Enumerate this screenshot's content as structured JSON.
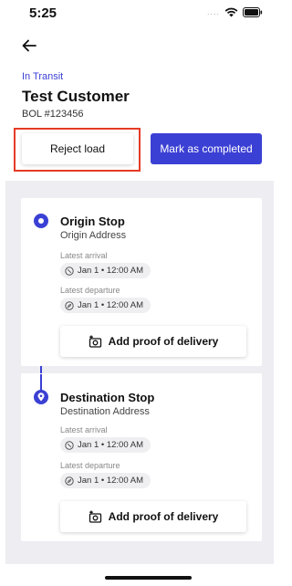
{
  "status_bar": {
    "time": "5:25",
    "signal": "....",
    "icons": [
      "wifi-icon",
      "battery-icon"
    ]
  },
  "header": {
    "back_icon": "arrow-left-icon"
  },
  "load": {
    "status": "In Transit",
    "customer": "Test Customer",
    "bol": "BOL #123456"
  },
  "actions": {
    "reject_label": "Reject load",
    "complete_label": "Mark as completed"
  },
  "stops": [
    {
      "title": "Origin Stop",
      "address": "Origin Address",
      "arrival_label": "Latest arrival",
      "arrival_value": "Jan 1 • 12:00 AM",
      "departure_label": "Latest departure",
      "departure_value": "Jan 1 • 12:00 AM",
      "proof_label": "Add proof of delivery"
    },
    {
      "title": "Destination Stop",
      "address": "Destination Address",
      "arrival_label": "Latest arrival",
      "arrival_value": "Jan 1 • 12:00 AM",
      "departure_label": "Latest departure",
      "departure_value": "Jan 1 • 12:00 AM",
      "proof_label": "Add proof of delivery"
    }
  ],
  "colors": {
    "accent": "#3b40d4",
    "highlight": "#e53b25",
    "background": "#ededf2"
  }
}
